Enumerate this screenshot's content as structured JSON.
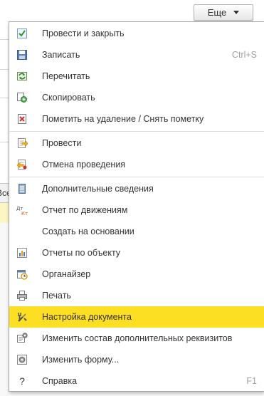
{
  "more_button": {
    "label": "Еще"
  },
  "background": {
    "tab_text": "Все"
  },
  "menu": {
    "items": [
      {
        "label": "Провести и закрыть",
        "icon": "post-and-close-icon"
      },
      {
        "label": "Записать",
        "icon": "save-icon",
        "shortcut": "Ctrl+S"
      },
      {
        "label": "Перечитать",
        "icon": "reread-icon"
      },
      {
        "label": "Скопировать",
        "icon": "copy-icon"
      },
      {
        "label": "Пометить на удаление / Снять пометку",
        "icon": "mark-delete-icon"
      },
      {
        "label": "Провести",
        "icon": "post-icon"
      },
      {
        "label": "Отмена проведения",
        "icon": "cancel-posting-icon"
      },
      {
        "label": "Дополнительные сведения",
        "icon": "additional-info-icon"
      },
      {
        "label": "Отчет по движениям",
        "icon": "movements-report-icon"
      },
      {
        "label": "Создать на основании",
        "icon": ""
      },
      {
        "label": "Отчеты по объекту",
        "icon": "object-reports-icon"
      },
      {
        "label": "Органайзер",
        "icon": "organizer-icon"
      },
      {
        "label": "Печать",
        "icon": "print-icon"
      },
      {
        "label": "Настройка документа",
        "icon": "document-settings-icon",
        "highlighted": true
      },
      {
        "label": "Изменить состав дополнительных реквизитов",
        "icon": "edit-attributes-icon"
      },
      {
        "label": "Изменить форму...",
        "icon": "change-form-icon"
      },
      {
        "label": "Справка",
        "icon": "help-icon",
        "shortcut": "F1"
      }
    ]
  },
  "colors": {
    "highlight": "#fcde22",
    "shortcut": "#a0a0a0",
    "border": "#a8a8a8"
  }
}
